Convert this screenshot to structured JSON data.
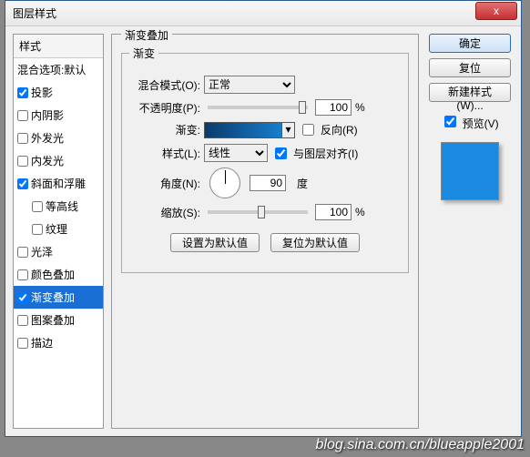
{
  "window": {
    "title": "图层样式",
    "close": "x"
  },
  "styles_header": "样式",
  "blend_options_label": "混合选项:默认",
  "styles": [
    {
      "label": "投影",
      "checked": true,
      "indent": false
    },
    {
      "label": "内阴影",
      "checked": false,
      "indent": false
    },
    {
      "label": "外发光",
      "checked": false,
      "indent": false
    },
    {
      "label": "内发光",
      "checked": false,
      "indent": false
    },
    {
      "label": "斜面和浮雕",
      "checked": true,
      "indent": false
    },
    {
      "label": "等高线",
      "checked": false,
      "indent": true
    },
    {
      "label": "纹理",
      "checked": false,
      "indent": true
    },
    {
      "label": "光泽",
      "checked": false,
      "indent": false
    },
    {
      "label": "颜色叠加",
      "checked": false,
      "indent": false
    },
    {
      "label": "渐变叠加",
      "checked": true,
      "indent": false,
      "selected": true
    },
    {
      "label": "图案叠加",
      "checked": false,
      "indent": false
    },
    {
      "label": "描边",
      "checked": false,
      "indent": false
    }
  ],
  "group": {
    "title_outer": "渐变叠加",
    "title_inner": "渐变",
    "blend_mode": {
      "label": "混合模式(O):",
      "value": "正常"
    },
    "opacity": {
      "label": "不透明度(P):",
      "value": "100",
      "unit": "%"
    },
    "gradient": {
      "label": "渐变:",
      "reverse_label": "反向(R)",
      "reverse_checked": false
    },
    "style": {
      "label": "样式(L):",
      "value": "线性",
      "align_label": "与图层对齐(I)",
      "align_checked": true
    },
    "angle": {
      "label": "角度(N):",
      "value": "90",
      "unit": "度"
    },
    "scale": {
      "label": "缩放(S):",
      "value": "100",
      "unit": "%"
    },
    "set_default": "设置为默认值",
    "reset_default": "复位为默认值"
  },
  "actions": {
    "ok": "确定",
    "cancel": "复位",
    "new_style": "新建样式(W)...",
    "preview_label": "预览(V)",
    "preview_checked": true
  },
  "watermark": "blog.sina.com.cn/blueapple2001"
}
